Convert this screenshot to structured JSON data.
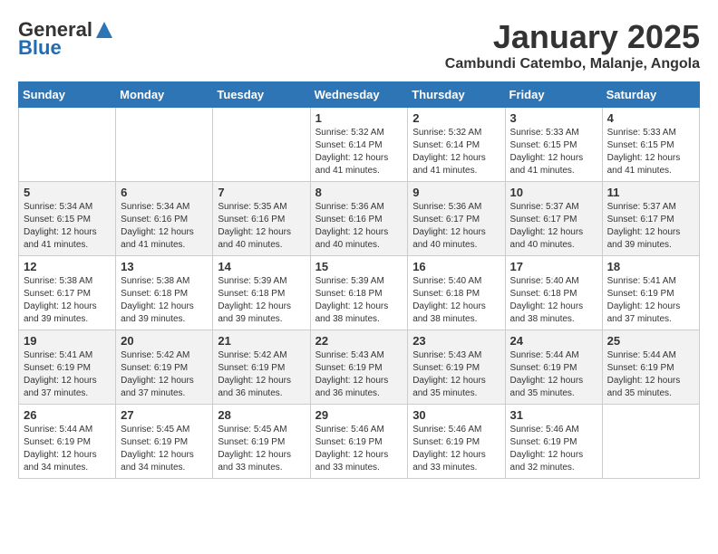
{
  "logo": {
    "general": "General",
    "blue": "Blue"
  },
  "title": {
    "month": "January 2025",
    "location": "Cambundi Catembo, Malanje, Angola"
  },
  "days_of_week": [
    "Sunday",
    "Monday",
    "Tuesday",
    "Wednesday",
    "Thursday",
    "Friday",
    "Saturday"
  ],
  "weeks": [
    [
      {
        "day": "",
        "info": ""
      },
      {
        "day": "",
        "info": ""
      },
      {
        "day": "",
        "info": ""
      },
      {
        "day": "1",
        "info": "Sunrise: 5:32 AM\nSunset: 6:14 PM\nDaylight: 12 hours and 41 minutes."
      },
      {
        "day": "2",
        "info": "Sunrise: 5:32 AM\nSunset: 6:14 PM\nDaylight: 12 hours and 41 minutes."
      },
      {
        "day": "3",
        "info": "Sunrise: 5:33 AM\nSunset: 6:15 PM\nDaylight: 12 hours and 41 minutes."
      },
      {
        "day": "4",
        "info": "Sunrise: 5:33 AM\nSunset: 6:15 PM\nDaylight: 12 hours and 41 minutes."
      }
    ],
    [
      {
        "day": "5",
        "info": "Sunrise: 5:34 AM\nSunset: 6:15 PM\nDaylight: 12 hours and 41 minutes."
      },
      {
        "day": "6",
        "info": "Sunrise: 5:34 AM\nSunset: 6:16 PM\nDaylight: 12 hours and 41 minutes."
      },
      {
        "day": "7",
        "info": "Sunrise: 5:35 AM\nSunset: 6:16 PM\nDaylight: 12 hours and 40 minutes."
      },
      {
        "day": "8",
        "info": "Sunrise: 5:36 AM\nSunset: 6:16 PM\nDaylight: 12 hours and 40 minutes."
      },
      {
        "day": "9",
        "info": "Sunrise: 5:36 AM\nSunset: 6:17 PM\nDaylight: 12 hours and 40 minutes."
      },
      {
        "day": "10",
        "info": "Sunrise: 5:37 AM\nSunset: 6:17 PM\nDaylight: 12 hours and 40 minutes."
      },
      {
        "day": "11",
        "info": "Sunrise: 5:37 AM\nSunset: 6:17 PM\nDaylight: 12 hours and 39 minutes."
      }
    ],
    [
      {
        "day": "12",
        "info": "Sunrise: 5:38 AM\nSunset: 6:17 PM\nDaylight: 12 hours and 39 minutes."
      },
      {
        "day": "13",
        "info": "Sunrise: 5:38 AM\nSunset: 6:18 PM\nDaylight: 12 hours and 39 minutes."
      },
      {
        "day": "14",
        "info": "Sunrise: 5:39 AM\nSunset: 6:18 PM\nDaylight: 12 hours and 39 minutes."
      },
      {
        "day": "15",
        "info": "Sunrise: 5:39 AM\nSunset: 6:18 PM\nDaylight: 12 hours and 38 minutes."
      },
      {
        "day": "16",
        "info": "Sunrise: 5:40 AM\nSunset: 6:18 PM\nDaylight: 12 hours and 38 minutes."
      },
      {
        "day": "17",
        "info": "Sunrise: 5:40 AM\nSunset: 6:18 PM\nDaylight: 12 hours and 38 minutes."
      },
      {
        "day": "18",
        "info": "Sunrise: 5:41 AM\nSunset: 6:19 PM\nDaylight: 12 hours and 37 minutes."
      }
    ],
    [
      {
        "day": "19",
        "info": "Sunrise: 5:41 AM\nSunset: 6:19 PM\nDaylight: 12 hours and 37 minutes."
      },
      {
        "day": "20",
        "info": "Sunrise: 5:42 AM\nSunset: 6:19 PM\nDaylight: 12 hours and 37 minutes."
      },
      {
        "day": "21",
        "info": "Sunrise: 5:42 AM\nSunset: 6:19 PM\nDaylight: 12 hours and 36 minutes."
      },
      {
        "day": "22",
        "info": "Sunrise: 5:43 AM\nSunset: 6:19 PM\nDaylight: 12 hours and 36 minutes."
      },
      {
        "day": "23",
        "info": "Sunrise: 5:43 AM\nSunset: 6:19 PM\nDaylight: 12 hours and 35 minutes."
      },
      {
        "day": "24",
        "info": "Sunrise: 5:44 AM\nSunset: 6:19 PM\nDaylight: 12 hours and 35 minutes."
      },
      {
        "day": "25",
        "info": "Sunrise: 5:44 AM\nSunset: 6:19 PM\nDaylight: 12 hours and 35 minutes."
      }
    ],
    [
      {
        "day": "26",
        "info": "Sunrise: 5:44 AM\nSunset: 6:19 PM\nDaylight: 12 hours and 34 minutes."
      },
      {
        "day": "27",
        "info": "Sunrise: 5:45 AM\nSunset: 6:19 PM\nDaylight: 12 hours and 34 minutes."
      },
      {
        "day": "28",
        "info": "Sunrise: 5:45 AM\nSunset: 6:19 PM\nDaylight: 12 hours and 33 minutes."
      },
      {
        "day": "29",
        "info": "Sunrise: 5:46 AM\nSunset: 6:19 PM\nDaylight: 12 hours and 33 minutes."
      },
      {
        "day": "30",
        "info": "Sunrise: 5:46 AM\nSunset: 6:19 PM\nDaylight: 12 hours and 33 minutes."
      },
      {
        "day": "31",
        "info": "Sunrise: 5:46 AM\nSunset: 6:19 PM\nDaylight: 12 hours and 32 minutes."
      },
      {
        "day": "",
        "info": ""
      }
    ]
  ]
}
